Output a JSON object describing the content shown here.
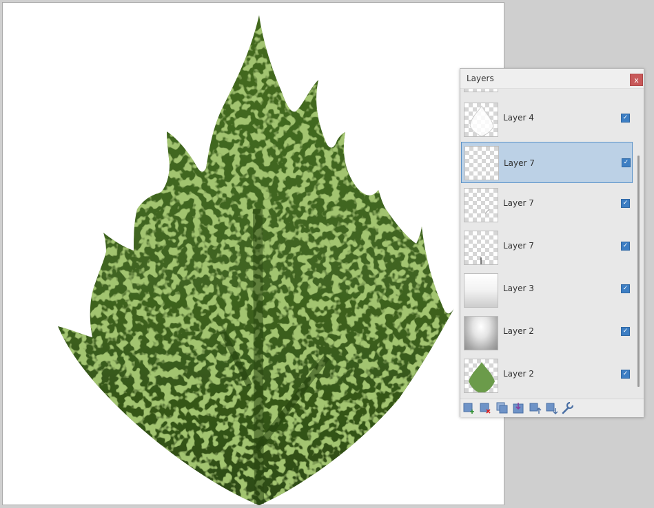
{
  "panel": {
    "title": "Layers",
    "close_label": "x"
  },
  "layers": [
    {
      "name": "Layer 4",
      "visible": true,
      "selected": false,
      "thumb": "leaf-outline"
    },
    {
      "name": "Layer 7",
      "visible": true,
      "selected": true,
      "thumb": "empty"
    },
    {
      "name": "Layer 7",
      "visible": true,
      "selected": false,
      "thumb": "small-stroke"
    },
    {
      "name": "Layer 7",
      "visible": true,
      "selected": false,
      "thumb": "vein-line"
    },
    {
      "name": "Layer 3",
      "visible": true,
      "selected": false,
      "thumb": "white-gradient"
    },
    {
      "name": "Layer 2",
      "visible": true,
      "selected": false,
      "thumb": "noise"
    },
    {
      "name": "Layer 2",
      "visible": true,
      "selected": false,
      "thumb": "green-leaf"
    }
  ],
  "toolbar": {
    "buttons": [
      "add-layer-icon",
      "delete-layer-icon",
      "duplicate-layer-icon",
      "merge-down-icon",
      "move-up-icon",
      "move-down-icon",
      "properties-wrench-icon"
    ]
  },
  "colors": {
    "leaf_dark": "#3a5d1c",
    "leaf_light": "#5a8a28",
    "selection": "#bcd1e6",
    "checkbox": "#3d7ec3",
    "close": "#c8595a"
  }
}
